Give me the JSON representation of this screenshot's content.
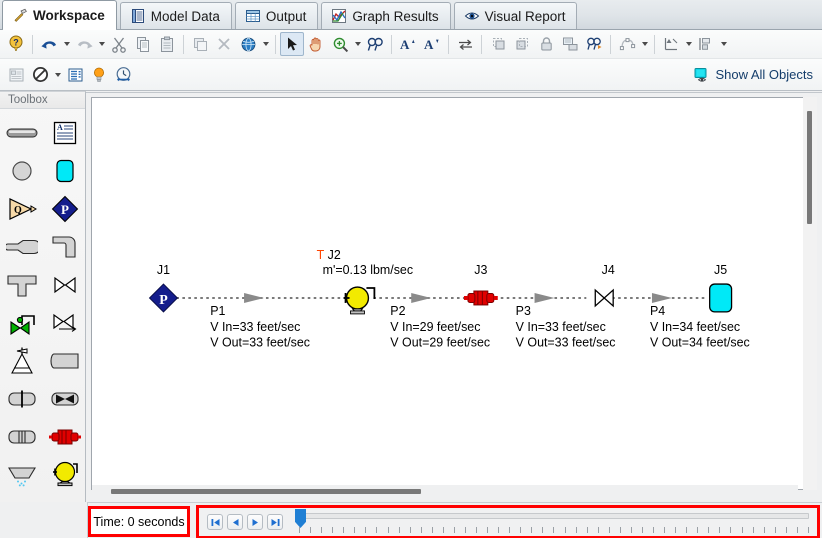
{
  "tabs": [
    {
      "label": "Workspace",
      "icon": "hammer-icon",
      "active": true
    },
    {
      "label": "Model Data",
      "icon": "notebook-icon",
      "active": false
    },
    {
      "label": "Output",
      "icon": "grid-table-icon",
      "active": false
    },
    {
      "label": "Graph Results",
      "icon": "chart-icon",
      "active": false
    },
    {
      "label": "Visual Report",
      "icon": "eye-icon",
      "active": false
    }
  ],
  "toolbar_primary": [
    {
      "name": "help-icon",
      "title": "Help"
    },
    {
      "name": "undo-icon",
      "title": "Undo"
    },
    {
      "name": "redo-icon",
      "title": "Redo"
    },
    {
      "name": "cut-icon",
      "title": "Cut"
    },
    {
      "name": "copy-icon",
      "title": "Copy"
    },
    {
      "name": "paste-icon",
      "title": "Paste"
    },
    {
      "name": "duplicate-icon",
      "title": "Duplicate"
    },
    {
      "name": "delete-icon",
      "title": "Delete"
    },
    {
      "name": "globe-icon",
      "title": "Global Edit"
    },
    {
      "name": "pointer-icon",
      "title": "Select"
    },
    {
      "name": "pan-hand-icon",
      "title": "Pan"
    },
    {
      "name": "zoom-icon",
      "title": "Zoom"
    },
    {
      "name": "find-icon",
      "title": "Find"
    },
    {
      "name": "font-increase-icon",
      "title": "Increase Font"
    },
    {
      "name": "font-decrease-icon",
      "title": "Decrease Font"
    },
    {
      "name": "reverse-icon",
      "title": "Reverse Direction"
    },
    {
      "name": "send-back-icon",
      "title": "Send To Back"
    },
    {
      "name": "bring-front-icon",
      "title": "Bring To Front"
    },
    {
      "name": "lock-icon",
      "title": "Lock Object"
    },
    {
      "name": "annotation-icon",
      "title": "Annotation"
    },
    {
      "name": "group-icon",
      "title": "Group"
    },
    {
      "name": "shape-icon",
      "title": "Draw Shape"
    },
    {
      "name": "align-icon",
      "title": "Align"
    },
    {
      "name": "distribute-icon",
      "title": "Distribute"
    }
  ],
  "toolbar_secondary": [
    {
      "name": "workspace-layers-icon",
      "title": "Workspace Layers"
    },
    {
      "name": "no-entry-icon",
      "title": "Disable Object"
    },
    {
      "name": "list-icon",
      "title": "Object List"
    },
    {
      "name": "bulb-icon",
      "title": "Highlight"
    },
    {
      "name": "clock-icon",
      "title": "Transient Control"
    }
  ],
  "show_all_objects": {
    "label": "Show All Objects",
    "icon": "show-objects-icon"
  },
  "toolbox": {
    "title": "Toolbox",
    "items": [
      {
        "name": "tool-pipe",
        "label": "Pipe"
      },
      {
        "name": "tool-annotation",
        "label": "Annotation"
      },
      {
        "name": "tool-branch",
        "label": "Branch"
      },
      {
        "name": "tool-tank",
        "label": "Tank"
      },
      {
        "name": "tool-assigned-flow",
        "label": "Assigned Flow"
      },
      {
        "name": "tool-assigned-pressure",
        "label": "Assigned Pressure"
      },
      {
        "name": "tool-area-change",
        "label": "Area Change"
      },
      {
        "name": "tool-bend",
        "label": "Bend"
      },
      {
        "name": "tool-tee",
        "label": "Tee / Wye"
      },
      {
        "name": "tool-valve",
        "label": "Valve"
      },
      {
        "name": "tool-control-valve",
        "label": "Control Valve"
      },
      {
        "name": "tool-check-valve",
        "label": "Check Valve"
      },
      {
        "name": "tool-spray-discharge",
        "label": "Spray Discharge"
      },
      {
        "name": "tool-reservoir",
        "label": "Reservoir"
      },
      {
        "name": "tool-orifice",
        "label": "Orifice"
      },
      {
        "name": "tool-venturi",
        "label": "Venturi"
      },
      {
        "name": "tool-screen",
        "label": "Screen"
      },
      {
        "name": "tool-pump",
        "label": "Pump"
      },
      {
        "name": "tool-heat-exchanger",
        "label": "Heat Exchanger"
      },
      {
        "name": "tool-centrifugal-pump",
        "label": "Centrifugal Pump"
      },
      {
        "name": "tool-general-component",
        "label": "General Component"
      },
      {
        "name": "tool-relief-valve",
        "label": "Relief Valve"
      }
    ]
  },
  "diagram": {
    "junctions": [
      {
        "id": "J1",
        "type": "assigned-pressure",
        "label": "J1",
        "flag": "",
        "sublabel": ""
      },
      {
        "id": "J2",
        "type": "pump",
        "label": "J2",
        "flag": "T",
        "sublabel": "m'=0.13 lbm/sec"
      },
      {
        "id": "J3",
        "type": "centrifugal-pump",
        "label": "J3",
        "flag": "",
        "sublabel": ""
      },
      {
        "id": "J4",
        "type": "valve",
        "label": "J4",
        "flag": "",
        "sublabel": ""
      },
      {
        "id": "J5",
        "type": "tank",
        "label": "J5",
        "flag": "",
        "sublabel": ""
      }
    ],
    "pipes": [
      {
        "id": "P1",
        "label": "P1",
        "v_in": "V In=33 feet/sec",
        "v_out": "V Out=33 feet/sec"
      },
      {
        "id": "P2",
        "label": "P2",
        "v_in": "V In=29 feet/sec",
        "v_out": "V Out=29 feet/sec"
      },
      {
        "id": "P3",
        "label": "P3",
        "v_in": "V In=33 feet/sec",
        "v_out": "V Out=33 feet/sec"
      },
      {
        "id": "P4",
        "label": "P4",
        "v_in": "V In=34 feet/sec",
        "v_out": "V Out=34 feet/sec"
      }
    ]
  },
  "statusbar": {
    "time_label": "Time: 0 seconds",
    "nav_buttons": [
      {
        "name": "jump-first-button",
        "glyph": "first"
      },
      {
        "name": "step-back-button",
        "glyph": "prev"
      },
      {
        "name": "step-forward-button",
        "glyph": "next"
      },
      {
        "name": "jump-last-button",
        "glyph": "last"
      }
    ],
    "slider_value": 0,
    "slider_tick_count": 47
  },
  "colors": {
    "highlight_border": "#ff0000",
    "accent_blue": "#1f7fd4",
    "junction_navy": "#1b1f8a",
    "tank_cyan": "#00e5ee",
    "pump_yellow": "#f5e500",
    "pump_red": "#e00000",
    "transient_flag": "#ff4500"
  }
}
